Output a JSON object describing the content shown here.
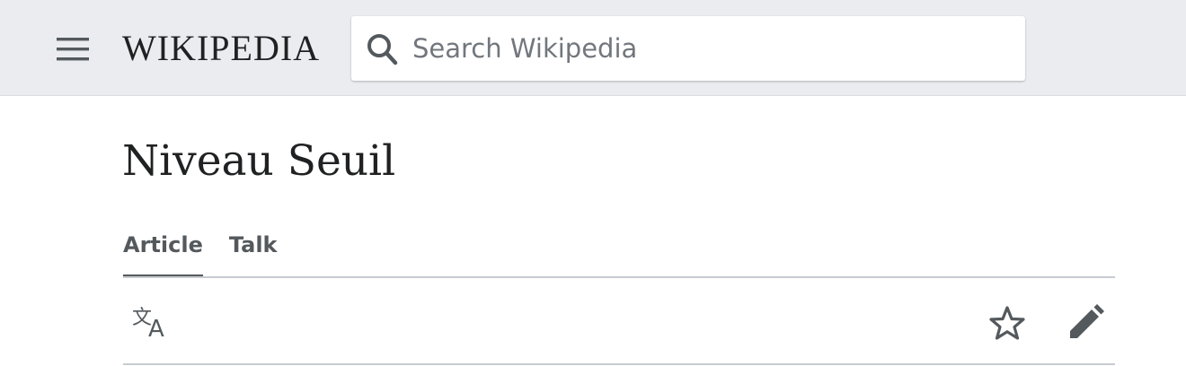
{
  "header": {
    "wordmark": "WIKIPEDIA",
    "search": {
      "placeholder": "Search Wikipedia",
      "value": ""
    },
    "icons": {
      "menu": "hamburger-menu-icon",
      "search": "search-icon"
    }
  },
  "page": {
    "title": "Niveau Seuil",
    "tabs": [
      {
        "label": "Article",
        "active": true
      },
      {
        "label": "Talk",
        "active": false
      }
    ],
    "actions": {
      "language": "language-icon",
      "watch": "star-icon",
      "edit": "pencil-icon"
    }
  },
  "colors": {
    "header_bg": "#eaecf0",
    "text": "#202122",
    "tab_text": "#54595d",
    "rule": "#c8ccd1",
    "placeholder": "#72777d"
  }
}
